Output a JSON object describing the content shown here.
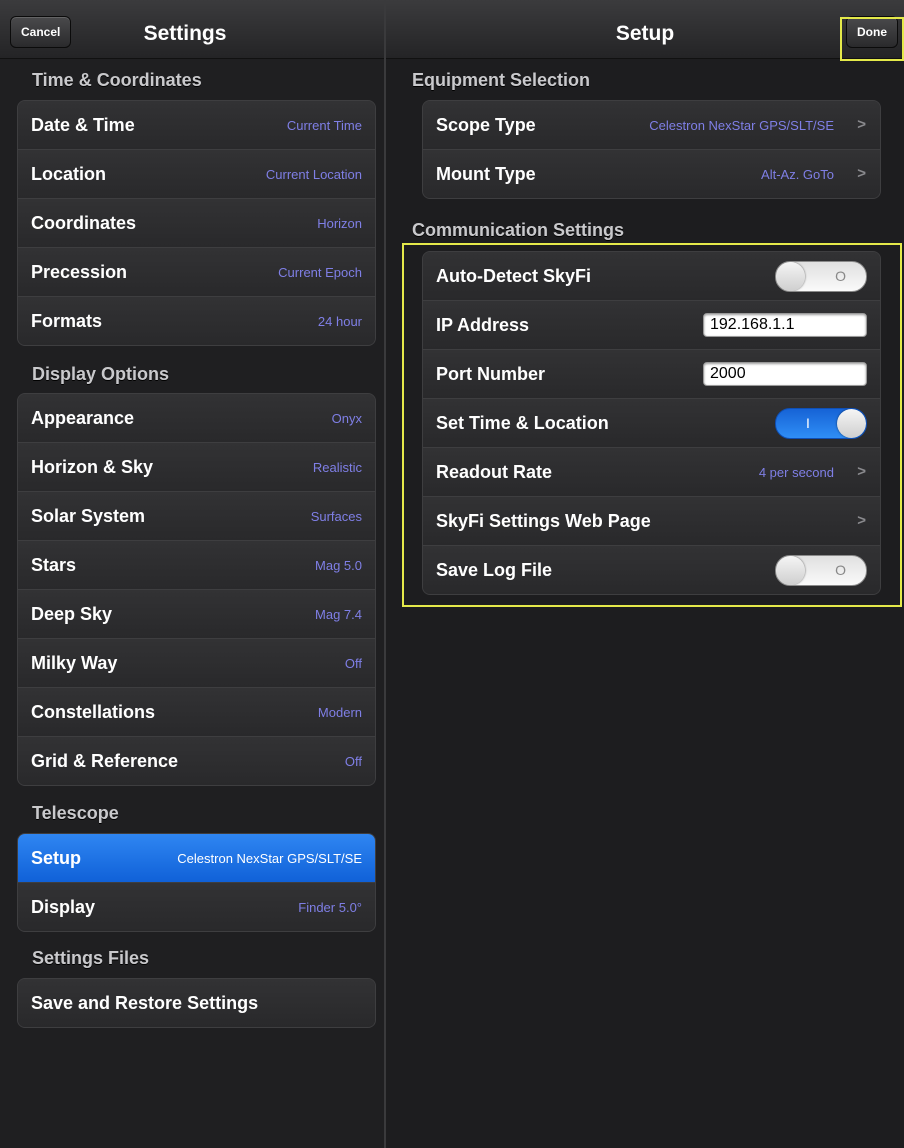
{
  "left": {
    "cancel_label": "Cancel",
    "title": "Settings",
    "sections": [
      {
        "header": "Time & Coordinates",
        "rows": [
          {
            "label": "Date & Time",
            "value": "Current Time"
          },
          {
            "label": "Location",
            "value": "Current Location"
          },
          {
            "label": "Coordinates",
            "value": "Horizon"
          },
          {
            "label": "Precession",
            "value": "Current Epoch"
          },
          {
            "label": "Formats",
            "value": "24 hour"
          }
        ]
      },
      {
        "header": "Display Options",
        "rows": [
          {
            "label": "Appearance",
            "value": "Onyx"
          },
          {
            "label": "Horizon & Sky",
            "value": "Realistic"
          },
          {
            "label": "Solar System",
            "value": "Surfaces"
          },
          {
            "label": "Stars",
            "value": "Mag 5.0"
          },
          {
            "label": "Deep Sky",
            "value": "Mag 7.4"
          },
          {
            "label": "Milky Way",
            "value": "Off"
          },
          {
            "label": "Constellations",
            "value": "Modern"
          },
          {
            "label": "Grid & Reference",
            "value": "Off"
          }
        ]
      },
      {
        "header": "Telescope",
        "rows": [
          {
            "label": "Setup",
            "value": "Celestron NexStar GPS/SLT/SE"
          },
          {
            "label": "Display",
            "value": "Finder 5.0°"
          }
        ]
      },
      {
        "header": "Settings Files",
        "rows": [
          {
            "label": "Save and Restore Settings",
            "value": ""
          }
        ]
      }
    ]
  },
  "right": {
    "title": "Setup",
    "done_label": "Done",
    "equipment": {
      "header": "Equipment Selection",
      "scope_label": "Scope Type",
      "scope_value": "Celestron NexStar GPS/SLT/SE",
      "mount_label": "Mount Type",
      "mount_value": "Alt-Az. GoTo"
    },
    "comm": {
      "header": "Communication Settings",
      "autodetect_label": "Auto-Detect SkyFi",
      "autodetect_on": false,
      "ip_label": "IP Address",
      "ip_value": "192.168.1.1",
      "port_label": "Port Number",
      "port_value": "2000",
      "settime_label": "Set Time & Location",
      "settime_on": true,
      "readout_label": "Readout Rate",
      "readout_value": "4 per second",
      "webpage_label": "SkyFi Settings Web Page",
      "log_label": "Save Log File",
      "log_on": false
    },
    "toggle_on_glyph": "I",
    "toggle_off_glyph": "O"
  },
  "colors": {
    "value_text": "#7f7fe6",
    "selected_row": "#1a6fe3",
    "highlight": "#e4e94a"
  }
}
